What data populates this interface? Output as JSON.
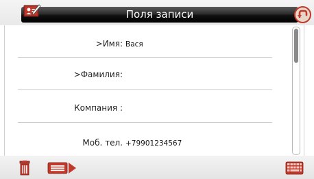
{
  "header": {
    "title": "Поля записи",
    "left_icon": "edit-contact-icon",
    "right_icon": "back-icon"
  },
  "fields": [
    {
      "label": ">Имя:",
      "value": "Вася"
    },
    {
      "label": ">Фамилия:",
      "value": ""
    },
    {
      "label": "Компания :",
      "value": ""
    },
    {
      "label": "Моб. тел.",
      "value": "+79901234567"
    }
  ],
  "footer": {
    "delete_icon": "trash-icon",
    "send_icon": "send-record-icon",
    "keyboard_icon": "keyboard-icon"
  },
  "scroll": {
    "position": 0.0
  },
  "colors": {
    "accent": "#c0392b",
    "title_bar": "#000000",
    "title_text": "#ffffff",
    "separator": "#c9c9c9"
  }
}
